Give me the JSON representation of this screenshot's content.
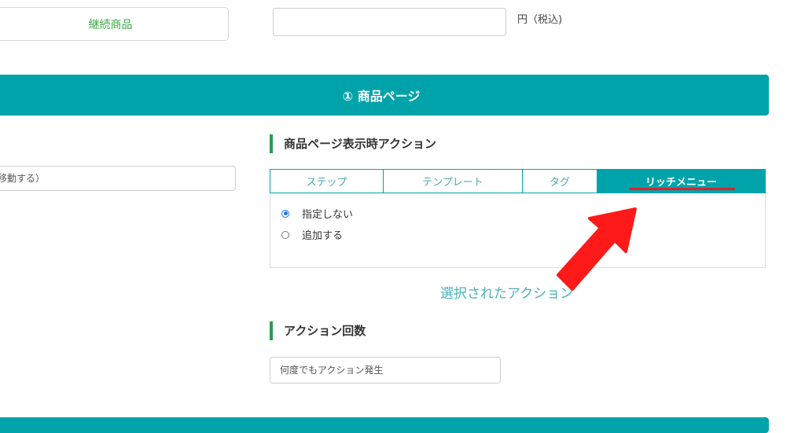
{
  "top": {
    "plan_button_label": "継続商品",
    "price_value": "",
    "price_unit": "円（税込)"
  },
  "section": {
    "title": "① 商品ページ"
  },
  "left_field": {
    "visible_text": "移動する）"
  },
  "action_section": {
    "heading": "商品ページ表示時アクション",
    "tabs": [
      {
        "label": "ステップ",
        "active": false
      },
      {
        "label": "テンプレート",
        "active": false
      },
      {
        "label": "タグ",
        "active": false
      },
      {
        "label": "リッチメニュー",
        "active": true
      }
    ],
    "options": [
      {
        "label": "指定しない",
        "checked": true
      },
      {
        "label": "追加する",
        "checked": false
      }
    ],
    "selected_actions_label": "選択されたアクション"
  },
  "count_section": {
    "heading": "アクション回数",
    "select_value": "何度でもアクション発生"
  },
  "colors": {
    "accent": "#00a3a9",
    "heading_rule": "#2a9d52",
    "annotation_arrow": "#ff1a1a",
    "underline": "#e0212b"
  }
}
